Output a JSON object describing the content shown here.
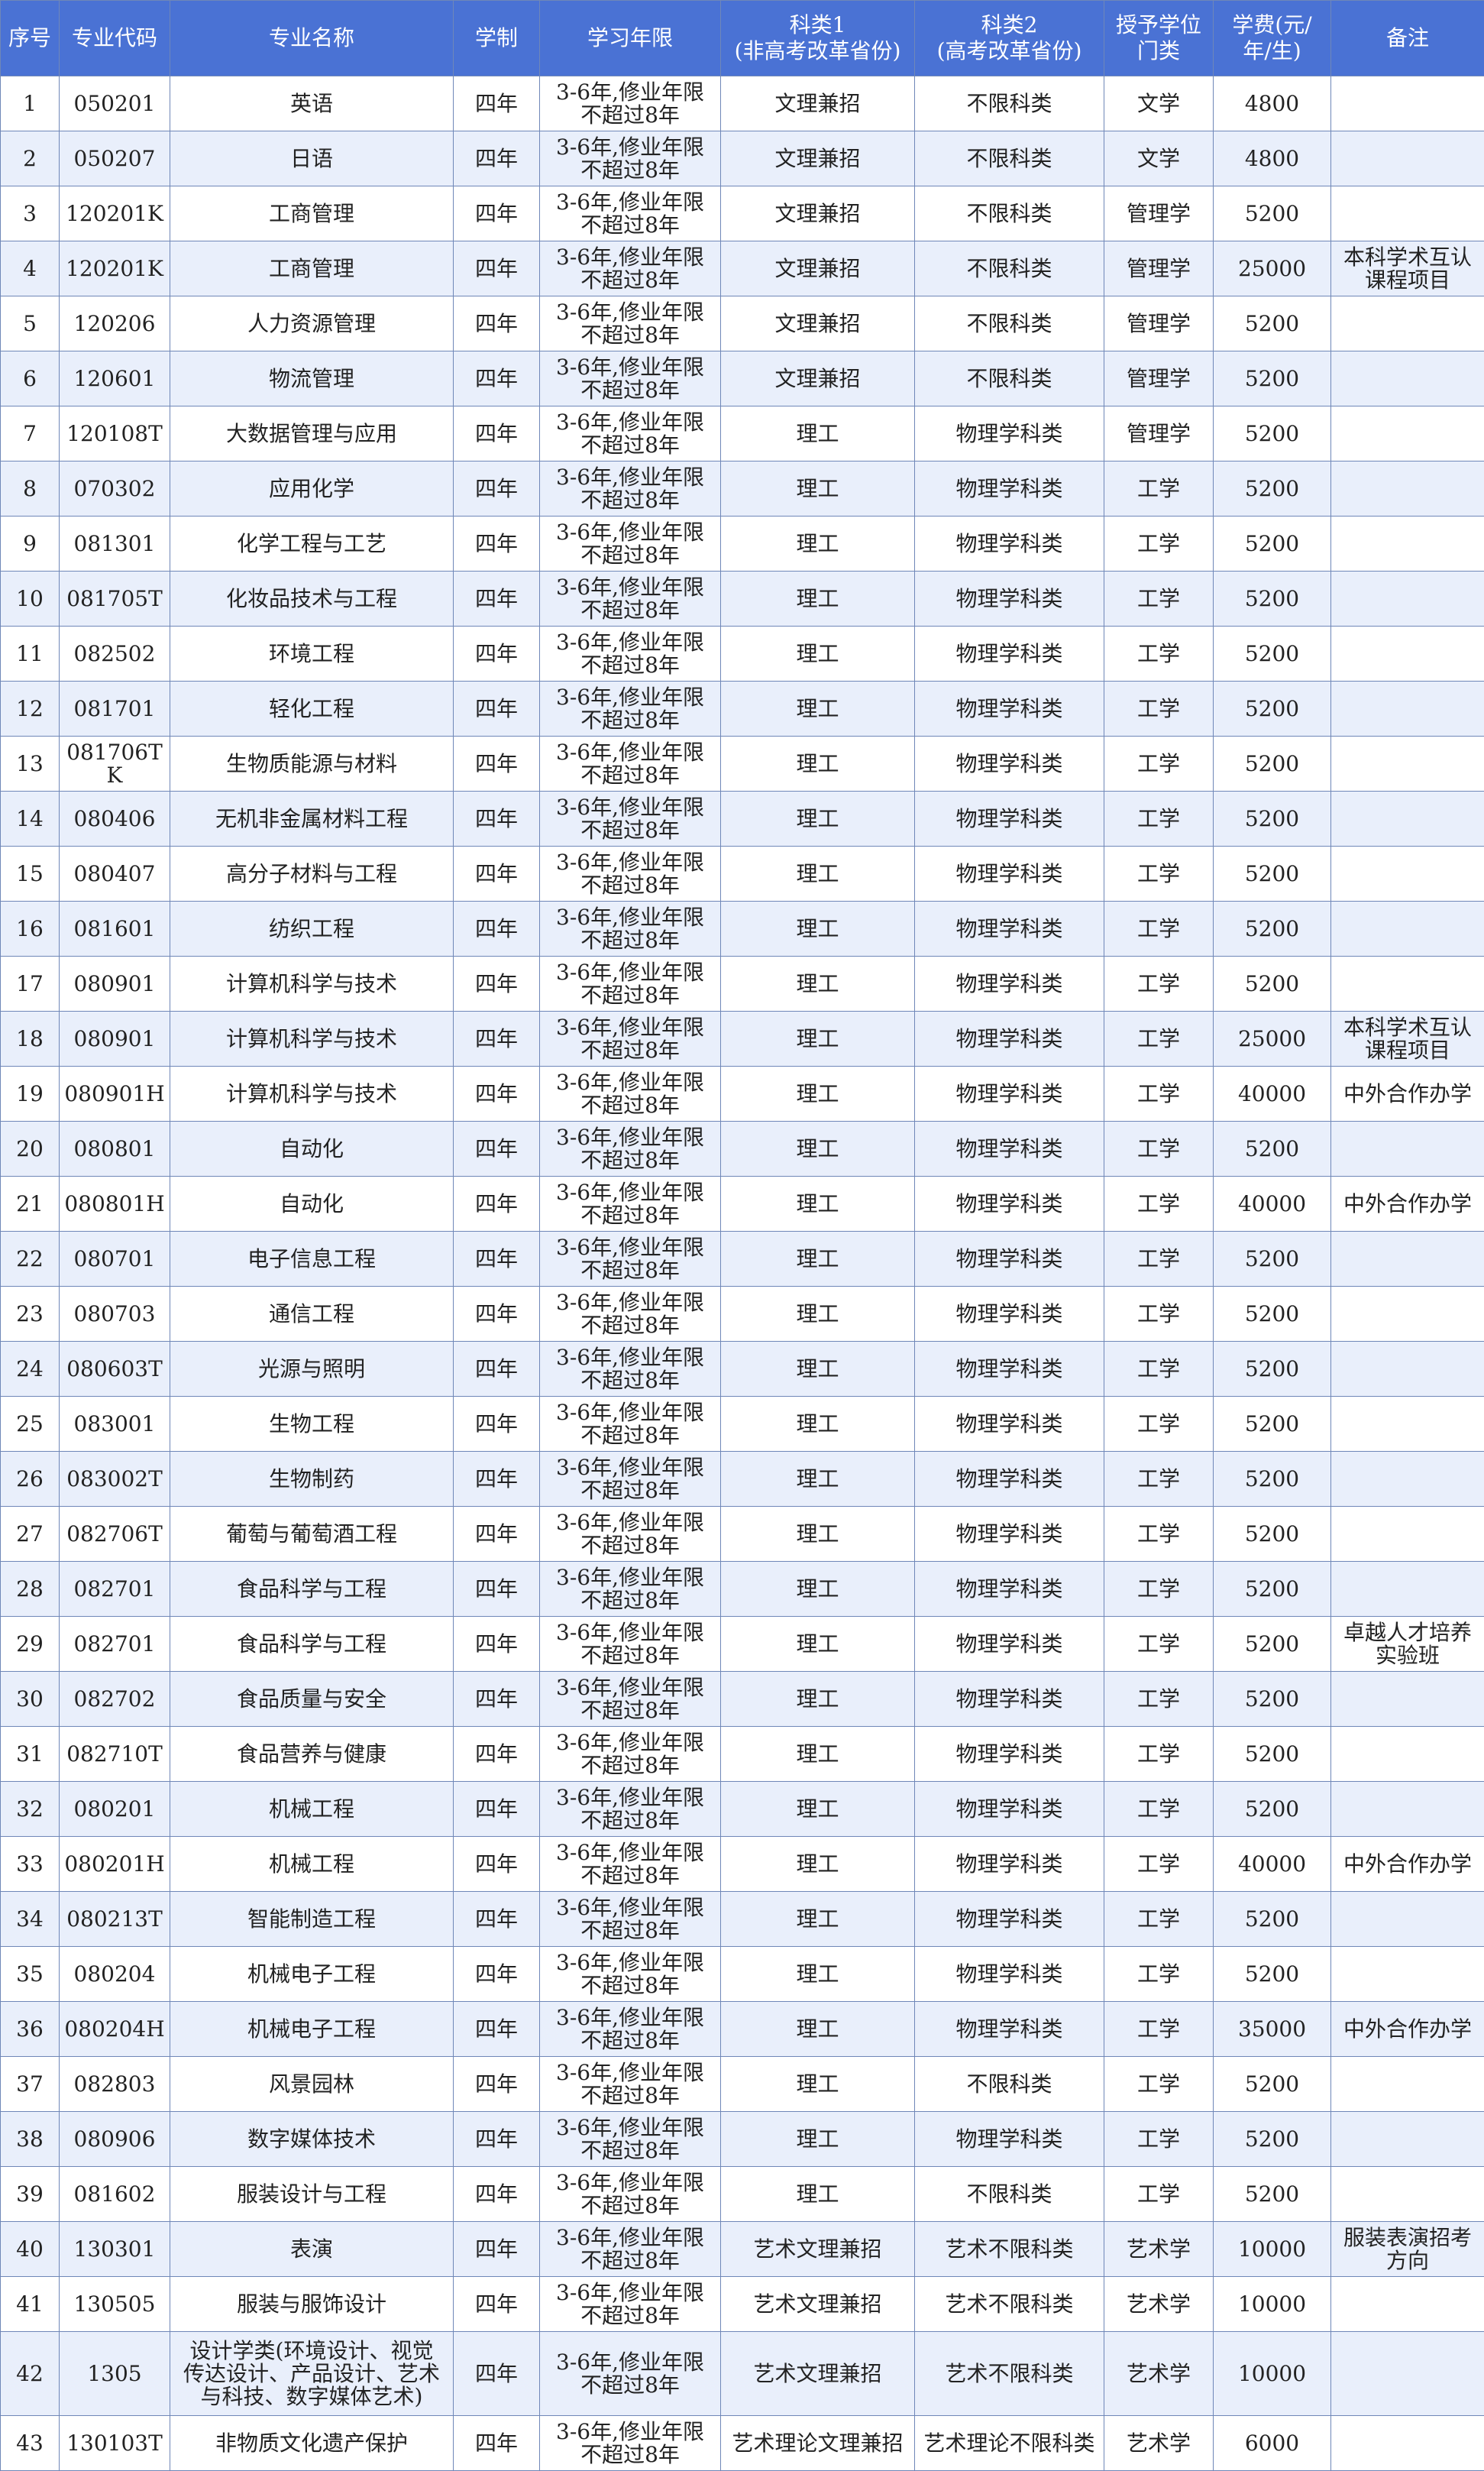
{
  "columns": [
    "序号",
    "专业代码",
    "专业名称",
    "学制",
    "学习年限",
    "科类1\n(非高考改革省份)",
    "科类2\n(高考改革省份)",
    "授予学位\n门类",
    "学费(元/\n年/生)",
    "备注"
  ],
  "rows": [
    [
      "1",
      "050201",
      "英语",
      "四年",
      "3-6年,修业年限\n不超过8年",
      "文理兼招",
      "不限科类",
      "文学",
      "4800",
      ""
    ],
    [
      "2",
      "050207",
      "日语",
      "四年",
      "3-6年,修业年限\n不超过8年",
      "文理兼招",
      "不限科类",
      "文学",
      "4800",
      ""
    ],
    [
      "3",
      "120201K",
      "工商管理",
      "四年",
      "3-6年,修业年限\n不超过8年",
      "文理兼招",
      "不限科类",
      "管理学",
      "5200",
      ""
    ],
    [
      "4",
      "120201K",
      "工商管理",
      "四年",
      "3-6年,修业年限\n不超过8年",
      "文理兼招",
      "不限科类",
      "管理学",
      "25000",
      "本科学术互认\n课程项目"
    ],
    [
      "5",
      "120206",
      "人力资源管理",
      "四年",
      "3-6年,修业年限\n不超过8年",
      "文理兼招",
      "不限科类",
      "管理学",
      "5200",
      ""
    ],
    [
      "6",
      "120601",
      "物流管理",
      "四年",
      "3-6年,修业年限\n不超过8年",
      "文理兼招",
      "不限科类",
      "管理学",
      "5200",
      ""
    ],
    [
      "7",
      "120108T",
      "大数据管理与应用",
      "四年",
      "3-6年,修业年限\n不超过8年",
      "理工",
      "物理学科类",
      "管理学",
      "5200",
      ""
    ],
    [
      "8",
      "070302",
      "应用化学",
      "四年",
      "3-6年,修业年限\n不超过8年",
      "理工",
      "物理学科类",
      "工学",
      "5200",
      ""
    ],
    [
      "9",
      "081301",
      "化学工程与工艺",
      "四年",
      "3-6年,修业年限\n不超过8年",
      "理工",
      "物理学科类",
      "工学",
      "5200",
      ""
    ],
    [
      "10",
      "081705T",
      "化妆品技术与工程",
      "四年",
      "3-6年,修业年限\n不超过8年",
      "理工",
      "物理学科类",
      "工学",
      "5200",
      ""
    ],
    [
      "11",
      "082502",
      "环境工程",
      "四年",
      "3-6年,修业年限\n不超过8年",
      "理工",
      "物理学科类",
      "工学",
      "5200",
      ""
    ],
    [
      "12",
      "081701",
      "轻化工程",
      "四年",
      "3-6年,修业年限\n不超过8年",
      "理工",
      "物理学科类",
      "工学",
      "5200",
      ""
    ],
    [
      "13",
      "081706TK",
      "生物质能源与材料",
      "四年",
      "3-6年,修业年限\n不超过8年",
      "理工",
      "物理学科类",
      "工学",
      "5200",
      ""
    ],
    [
      "14",
      "080406",
      "无机非金属材料工程",
      "四年",
      "3-6年,修业年限\n不超过8年",
      "理工",
      "物理学科类",
      "工学",
      "5200",
      ""
    ],
    [
      "15",
      "080407",
      "高分子材料与工程",
      "四年",
      "3-6年,修业年限\n不超过8年",
      "理工",
      "物理学科类",
      "工学",
      "5200",
      ""
    ],
    [
      "16",
      "081601",
      "纺织工程",
      "四年",
      "3-6年,修业年限\n不超过8年",
      "理工",
      "物理学科类",
      "工学",
      "5200",
      ""
    ],
    [
      "17",
      "080901",
      "计算机科学与技术",
      "四年",
      "3-6年,修业年限\n不超过8年",
      "理工",
      "物理学科类",
      "工学",
      "5200",
      ""
    ],
    [
      "18",
      "080901",
      "计算机科学与技术",
      "四年",
      "3-6年,修业年限\n不超过8年",
      "理工",
      "物理学科类",
      "工学",
      "25000",
      "本科学术互认\n课程项目"
    ],
    [
      "19",
      "080901H",
      "计算机科学与技术",
      "四年",
      "3-6年,修业年限\n不超过8年",
      "理工",
      "物理学科类",
      "工学",
      "40000",
      "中外合作办学"
    ],
    [
      "20",
      "080801",
      "自动化",
      "四年",
      "3-6年,修业年限\n不超过8年",
      "理工",
      "物理学科类",
      "工学",
      "5200",
      ""
    ],
    [
      "21",
      "080801H",
      "自动化",
      "四年",
      "3-6年,修业年限\n不超过8年",
      "理工",
      "物理学科类",
      "工学",
      "40000",
      "中外合作办学"
    ],
    [
      "22",
      "080701",
      "电子信息工程",
      "四年",
      "3-6年,修业年限\n不超过8年",
      "理工",
      "物理学科类",
      "工学",
      "5200",
      ""
    ],
    [
      "23",
      "080703",
      "通信工程",
      "四年",
      "3-6年,修业年限\n不超过8年",
      "理工",
      "物理学科类",
      "工学",
      "5200",
      ""
    ],
    [
      "24",
      "080603T",
      "光源与照明",
      "四年",
      "3-6年,修业年限\n不超过8年",
      "理工",
      "物理学科类",
      "工学",
      "5200",
      ""
    ],
    [
      "25",
      "083001",
      "生物工程",
      "四年",
      "3-6年,修业年限\n不超过8年",
      "理工",
      "物理学科类",
      "工学",
      "5200",
      ""
    ],
    [
      "26",
      "083002T",
      "生物制药",
      "四年",
      "3-6年,修业年限\n不超过8年",
      "理工",
      "物理学科类",
      "工学",
      "5200",
      ""
    ],
    [
      "27",
      "082706T",
      "葡萄与葡萄酒工程",
      "四年",
      "3-6年,修业年限\n不超过8年",
      "理工",
      "物理学科类",
      "工学",
      "5200",
      ""
    ],
    [
      "28",
      "082701",
      "食品科学与工程",
      "四年",
      "3-6年,修业年限\n不超过8年",
      "理工",
      "物理学科类",
      "工学",
      "5200",
      ""
    ],
    [
      "29",
      "082701",
      "食品科学与工程",
      "四年",
      "3-6年,修业年限\n不超过8年",
      "理工",
      "物理学科类",
      "工学",
      "5200",
      "卓越人才培养\n实验班"
    ],
    [
      "30",
      "082702",
      "食品质量与安全",
      "四年",
      "3-6年,修业年限\n不超过8年",
      "理工",
      "物理学科类",
      "工学",
      "5200",
      ""
    ],
    [
      "31",
      "082710T",
      "食品营养与健康",
      "四年",
      "3-6年,修业年限\n不超过8年",
      "理工",
      "物理学科类",
      "工学",
      "5200",
      ""
    ],
    [
      "32",
      "080201",
      "机械工程",
      "四年",
      "3-6年,修业年限\n不超过8年",
      "理工",
      "物理学科类",
      "工学",
      "5200",
      ""
    ],
    [
      "33",
      "080201H",
      "机械工程",
      "四年",
      "3-6年,修业年限\n不超过8年",
      "理工",
      "物理学科类",
      "工学",
      "40000",
      "中外合作办学"
    ],
    [
      "34",
      "080213T",
      "智能制造工程",
      "四年",
      "3-6年,修业年限\n不超过8年",
      "理工",
      "物理学科类",
      "工学",
      "5200",
      ""
    ],
    [
      "35",
      "080204",
      "机械电子工程",
      "四年",
      "3-6年,修业年限\n不超过8年",
      "理工",
      "物理学科类",
      "工学",
      "5200",
      ""
    ],
    [
      "36",
      "080204H",
      "机械电子工程",
      "四年",
      "3-6年,修业年限\n不超过8年",
      "理工",
      "物理学科类",
      "工学",
      "35000",
      "中外合作办学"
    ],
    [
      "37",
      "082803",
      "风景园林",
      "四年",
      "3-6年,修业年限\n不超过8年",
      "理工",
      "不限科类",
      "工学",
      "5200",
      ""
    ],
    [
      "38",
      "080906",
      "数字媒体技术",
      "四年",
      "3-6年,修业年限\n不超过8年",
      "理工",
      "物理学科类",
      "工学",
      "5200",
      ""
    ],
    [
      "39",
      "081602",
      "服装设计与工程",
      "四年",
      "3-6年,修业年限\n不超过8年",
      "理工",
      "不限科类",
      "工学",
      "5200",
      ""
    ],
    [
      "40",
      "130301",
      "表演",
      "四年",
      "3-6年,修业年限\n不超过8年",
      "艺术文理兼招",
      "艺术不限科类",
      "艺术学",
      "10000",
      "服装表演招考\n方向"
    ],
    [
      "41",
      "130505",
      "服装与服饰设计",
      "四年",
      "3-6年,修业年限\n不超过8年",
      "艺术文理兼招",
      "艺术不限科类",
      "艺术学",
      "10000",
      ""
    ],
    [
      "42",
      "1305",
      "设计学类(环境设计、视觉\n传达设计、产品设计、艺术\n与科技、数字媒体艺术)",
      "四年",
      "3-6年,修业年限\n不超过8年",
      "艺术文理兼招",
      "艺术不限科类",
      "艺术学",
      "10000",
      ""
    ],
    [
      "43",
      "130103T",
      "非物质文化遗产保护",
      "四年",
      "3-6年,修业年限\n不超过8年",
      "艺术理论文理兼招",
      "艺术理论不限科类",
      "艺术学",
      "6000",
      ""
    ]
  ],
  "colors": {
    "header_bg": "#4a72d4",
    "header_text": "#ffffff",
    "row_alt_bg": "#e9effb",
    "border": "#6f87b8"
  }
}
